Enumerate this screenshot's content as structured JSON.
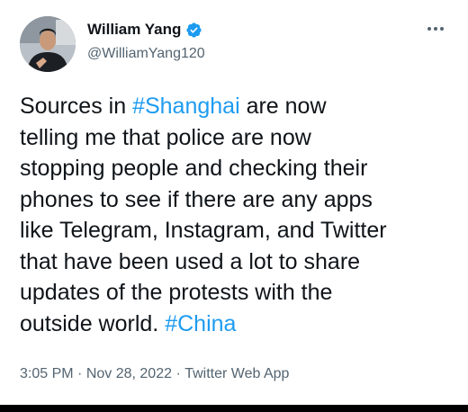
{
  "author": {
    "name": "William Yang",
    "handle": "@WilliamYang120",
    "verified": true
  },
  "tweet": {
    "text_parts": [
      {
        "type": "text",
        "value": "Sources in "
      },
      {
        "type": "hashtag",
        "value": "#Shanghai"
      },
      {
        "type": "text",
        "value": " are now\ntelling me that police are now\nstopping people and checking their\nphones to see if there are any apps\nlike Telegram, Instagram, and Twitter\nthat have been used a lot to share\nupdates of the protests with the\noutside world. "
      },
      {
        "type": "hashtag",
        "value": "#China"
      }
    ]
  },
  "meta": {
    "time": "3:05 PM",
    "separator": " · ",
    "date": "Nov 28, 2022",
    "source": "Twitter Web App"
  },
  "colors": {
    "link": "#1d9bf0",
    "secondary_text": "#536471",
    "verified_badge": "#1d9bf0"
  },
  "icons": {
    "verified": "verified-badge-icon",
    "more": "more-options-icon"
  }
}
